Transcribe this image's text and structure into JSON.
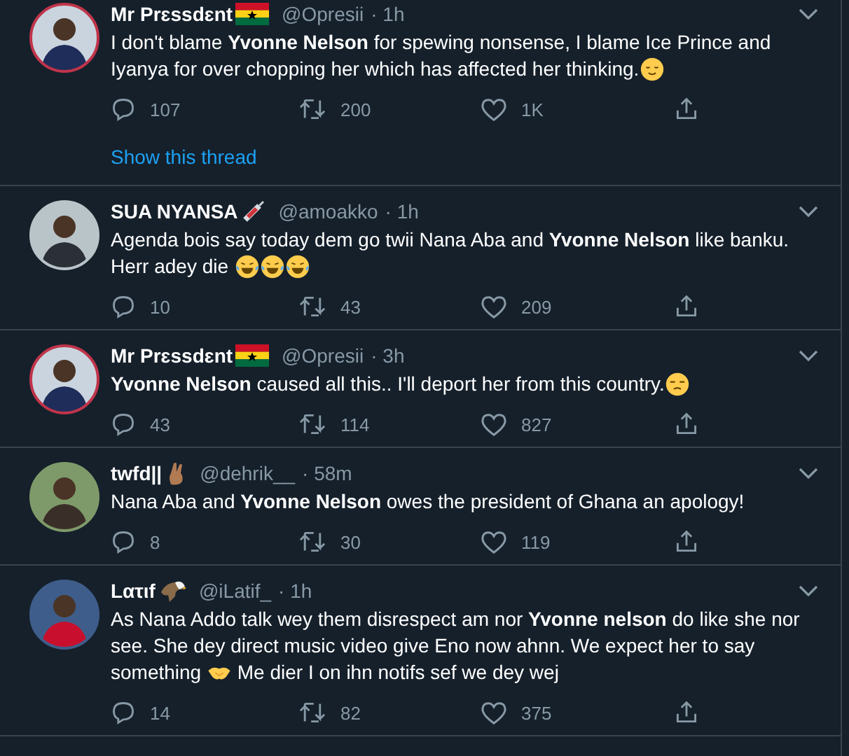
{
  "tweets": [
    {
      "name": "Mr Prɛssdɛnt",
      "badge": {
        "kind": "flag"
      },
      "handle": "@Opresii",
      "time": "· 1h",
      "body": [
        {
          "kind": "text",
          "text": "I don't blame **Yvonne Nelson** for spewing nonsense, I blame Ice Prince and Iyanya for over chopping her which has affected her thinking."
        },
        {
          "kind": "relieved-emoji"
        }
      ],
      "replies": "107",
      "retweets": "200",
      "likes": "1K",
      "thread": "Show this thread"
    },
    {
      "name": "SUA NYANSA",
      "badge": {
        "kind": "syringe"
      },
      "handle": "@amoakko",
      "time": "· 1h",
      "body": [
        {
          "kind": "text",
          "text": "Agenda bois say today dem go twii Nana Aba and **Yvonne Nelson** like banku. Herr adey die "
        },
        {
          "kind": "laughing-emoji"
        },
        {
          "kind": "laughing-emoji"
        },
        {
          "kind": "laughing-emoji"
        }
      ],
      "replies": "10",
      "retweets": "43",
      "likes": "209"
    },
    {
      "name": "Mr Prɛssdɛnt",
      "badge": {
        "kind": "flag"
      },
      "handle": "@Opresii",
      "time": "· 3h",
      "body": [
        {
          "kind": "text",
          "text": "**Yvonne Nelson** caused all this.. I'll deport her from this country."
        },
        {
          "kind": "unamused-emoji"
        }
      ],
      "replies": "43",
      "retweets": "114",
      "likes": "827"
    },
    {
      "name": "twfd||",
      "badge": {
        "kind": "fingers"
      },
      "handle": "@dehrik__",
      "time": "· 58m",
      "body": [
        {
          "kind": "text",
          "text": "Nana Aba and **Yvonne Nelson** owes the president of Ghana an apology!"
        }
      ],
      "replies": "8",
      "retweets": "30",
      "likes": "119"
    },
    {
      "name": "Lατιf",
      "badge": {
        "kind": "eagle"
      },
      "handle": "@iLatif_",
      "time": "· 1h",
      "body": [
        {
          "kind": "text",
          "text": "As Nana Addo talk wey them disrespect am nor **Yvonne nelson** do like she nor see. She dey direct music video give Eno now ahnn. We expect her to say something "
        },
        {
          "kind": "hands-emoji"
        },
        {
          "kind": "text",
          "text": " Me dier I on ihn notifs sef we dey wej"
        }
      ],
      "replies": "14",
      "retweets": "82",
      "likes": "375"
    }
  ]
}
